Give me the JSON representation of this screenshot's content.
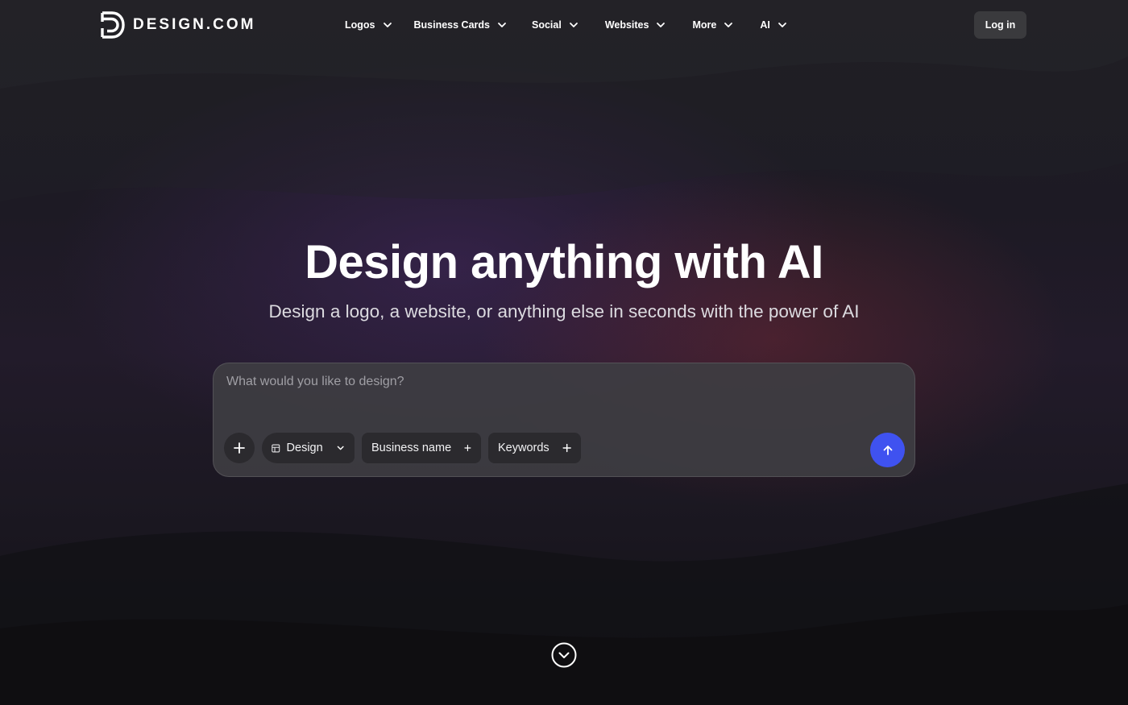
{
  "brand": {
    "name": "DESIGN.COM",
    "logo_icon": "design-com-d-logo-icon"
  },
  "nav": {
    "items": [
      {
        "label": "Logos",
        "icon": "chevron-down-icon"
      },
      {
        "label": "Business Cards",
        "icon": "chevron-down-icon"
      },
      {
        "label": "Social",
        "icon": "chevron-down-icon"
      },
      {
        "label": "Websites",
        "icon": "chevron-down-icon"
      },
      {
        "label": "More",
        "icon": "chevron-down-icon"
      },
      {
        "label": "AI",
        "icon": "chevron-down-icon"
      }
    ],
    "login_label": "Log in"
  },
  "hero": {
    "title": "Design anything with AI",
    "subtitle": "Design a logo, a website, or anything else in seconds with the power of AI"
  },
  "prompt": {
    "placeholder": "What would you like to design?",
    "value": "",
    "chips": {
      "design": {
        "label": "Design",
        "icon": "layout-icon"
      },
      "business_name": {
        "label": "Business name",
        "icon": "plus-icon"
      },
      "keywords": {
        "label": "Keywords",
        "icon": "plus-icon"
      }
    },
    "add_icon": "plus-icon",
    "send_icon": "arrow-up-icon"
  },
  "colors": {
    "accent": "#3f52f0",
    "background": "#17161b",
    "panel": "#3e3d42",
    "chip": "#2b2a2e",
    "login_button": "#3a3a3d"
  },
  "scroll_icon": "chevron-down-circle-icon"
}
